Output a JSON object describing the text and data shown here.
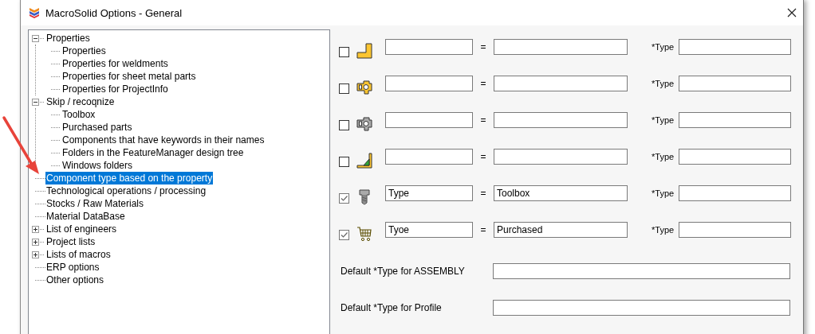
{
  "window": {
    "title": "MacroSolid Options - General"
  },
  "tree": [
    {
      "label": "Properties",
      "expanded": true,
      "selected": false,
      "children": [
        {
          "label": "Properties",
          "selected": false
        },
        {
          "label": "Properties for weldments",
          "selected": false
        },
        {
          "label": "Properties for sheet metal parts",
          "selected": false
        },
        {
          "label": "Properties for ProjectInfo",
          "selected": false
        }
      ]
    },
    {
      "label": "Skip / recoqnize",
      "expanded": true,
      "selected": false,
      "children": [
        {
          "label": "Toolbox",
          "selected": false
        },
        {
          "label": "Purchased parts",
          "selected": false
        },
        {
          "label": "Components that have keywords in their names",
          "selected": false
        },
        {
          "label": "Folders in the FeatureManager design tree",
          "selected": false
        },
        {
          "label": "Windows folders",
          "selected": false
        }
      ]
    },
    {
      "label": "Component type based on the property",
      "selected": true
    },
    {
      "label": "Technological operations / processing",
      "selected": false
    },
    {
      "label": "Stocks / Raw Materials",
      "selected": false
    },
    {
      "label": "Material DataBase",
      "selected": false
    },
    {
      "label": "List of engineers",
      "expanded": false,
      "selected": false
    },
    {
      "label": "Project lists",
      "expanded": false,
      "selected": false
    },
    {
      "label": "Lists of macros",
      "expanded": false,
      "selected": false
    },
    {
      "label": "ERP options",
      "selected": false
    },
    {
      "label": "Other options",
      "selected": false
    }
  ],
  "rules": [
    {
      "kind": "plate",
      "checked": false,
      "equals": "=",
      "type_label": "*Type"
    },
    {
      "kind": "assembly",
      "checked": false,
      "equals": "=",
      "type_label": "*Type"
    },
    {
      "kind": "assembly-gray",
      "checked": false,
      "equals": "=",
      "type_label": "*Type"
    },
    {
      "kind": "weld",
      "checked": false,
      "equals": "=",
      "type_label": "*Type"
    },
    {
      "kind": "bolt",
      "checked": true,
      "property": "Type",
      "equals": "=",
      "value": "Toolbox",
      "type_label": "*Type"
    },
    {
      "kind": "cart",
      "checked": true,
      "property": "Tyoe",
      "equals": "=",
      "value": "Purchased",
      "type_label": "*Type"
    }
  ],
  "defaults": [
    {
      "label": "Default *Type for ASSEMBLY"
    },
    {
      "label": "Default *Type for Profile"
    }
  ]
}
